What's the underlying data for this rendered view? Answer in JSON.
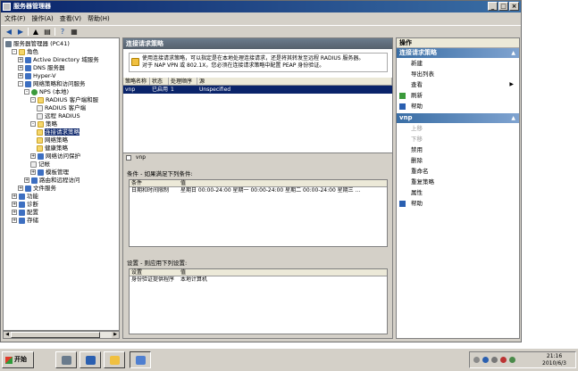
{
  "window": {
    "title": "服务器管理器",
    "controls": [
      "_",
      "□",
      "×"
    ]
  },
  "menu": [
    "文件(F)",
    "操作(A)",
    "查看(V)",
    "帮助(H)"
  ],
  "tree": [
    {
      "label": "服务器管理器 (PC41)",
      "icon": "server-icon",
      "level": 0,
      "expand": ""
    },
    {
      "label": "角色",
      "icon": "folder-icon",
      "level": 1,
      "expand": "-"
    },
    {
      "label": "Active Directory 域服务",
      "icon": "ad-icon",
      "level": 2,
      "expand": "+"
    },
    {
      "label": "DNS 服务器",
      "icon": "dns-icon",
      "level": 2,
      "expand": "+"
    },
    {
      "label": "Hyper-V",
      "icon": "hyperv-icon",
      "level": 2,
      "expand": "+"
    },
    {
      "label": "网络策略和访问服务",
      "icon": "nps-icon",
      "level": 2,
      "expand": "-"
    },
    {
      "label": "NPS (本地)",
      "icon": "globe-icon",
      "level": 3,
      "expand": "-"
    },
    {
      "label": "RADIUS 客户端和服",
      "icon": "folder-icon",
      "level": 4,
      "expand": "-"
    },
    {
      "label": "RADIUS 客户端",
      "icon": "doc-icon",
      "level": 5,
      "expand": ""
    },
    {
      "label": "远程 RADIUS",
      "icon": "doc-icon",
      "level": 5,
      "expand": ""
    },
    {
      "label": "策略",
      "icon": "folder-icon",
      "level": 4,
      "expand": "-"
    },
    {
      "label": "连接请求策略",
      "icon": "folder-icon",
      "level": 5,
      "expand": "",
      "selected": true
    },
    {
      "label": "网络策略",
      "icon": "folder-icon",
      "level": 5,
      "expand": ""
    },
    {
      "label": "健康策略",
      "icon": "folder-icon",
      "level": 5,
      "expand": ""
    },
    {
      "label": "网络访问保护",
      "icon": "nap-icon",
      "level": 4,
      "expand": "+"
    },
    {
      "label": "记帐",
      "icon": "doc-icon",
      "level": 4,
      "expand": ""
    },
    {
      "label": "模板管理",
      "icon": "template-icon",
      "level": 4,
      "expand": "+"
    },
    {
      "label": "路由和远程访问",
      "icon": "routing-icon",
      "level": 3,
      "expand": "+"
    },
    {
      "label": "文件服务",
      "icon": "file-service-icon",
      "level": 2,
      "expand": "+"
    },
    {
      "label": "功能",
      "icon": "features-icon",
      "level": 1,
      "expand": "+"
    },
    {
      "label": "诊断",
      "icon": "diagnostics-icon",
      "level": 1,
      "expand": "+"
    },
    {
      "label": "配置",
      "icon": "config-icon",
      "level": 1,
      "expand": "+"
    },
    {
      "label": "存储",
      "icon": "storage-icon",
      "level": 1,
      "expand": "+"
    }
  ],
  "center": {
    "header": "连接请求策略",
    "info_line1": "使用连接请求策略，可以指定是在本地处理连接请求，还是将其转发至远程 RADIUS 服务器。",
    "info_line2": "对于 NAP VPN 或 802.1X，您必须在连接请求策略中配置 PEAP 身份验证。",
    "columns": [
      "策略名称",
      "状态",
      "处理顺序",
      "源"
    ],
    "rows": [
      [
        "vnp",
        "已启用",
        "1",
        "Unspecified"
      ]
    ],
    "detail_title": "vnp",
    "conditions_title": "条件 - 如果满足下列条件:",
    "conditions_columns": [
      "条件",
      "值"
    ],
    "conditions_rows": [
      [
        "日期和时间限制",
        "星期日 00:00-24:00 星期一 00:00-24:00 星期二 00:00-24:00 星期三 ..."
      ]
    ],
    "settings_title": "设置 - 则应用下列设置:",
    "settings_columns": [
      "设置",
      "值"
    ],
    "settings_rows": [
      [
        "身份验证提供程序",
        "本地计算机"
      ]
    ]
  },
  "actions": {
    "header": "操作",
    "section1": "连接请求策略",
    "items1": [
      {
        "label": "新建",
        "icon": ""
      },
      {
        "label": "导出列表",
        "icon": ""
      },
      {
        "label": "查看",
        "icon": "",
        "submenu": true
      },
      {
        "label": "刷新",
        "icon": "refresh-icon"
      },
      {
        "label": "帮助",
        "icon": "help-icon"
      }
    ],
    "section2": "vnp",
    "items2": [
      {
        "label": "上移",
        "disabled": true
      },
      {
        "label": "下移",
        "disabled": true
      },
      {
        "label": "禁用"
      },
      {
        "label": "删除"
      },
      {
        "label": "重命名"
      },
      {
        "label": "重复策略"
      },
      {
        "label": "属性"
      },
      {
        "label": "帮助",
        "icon": "help-icon"
      }
    ]
  },
  "taskbar": {
    "start": "开始",
    "time": "21:16",
    "date": "2010/6/3"
  }
}
